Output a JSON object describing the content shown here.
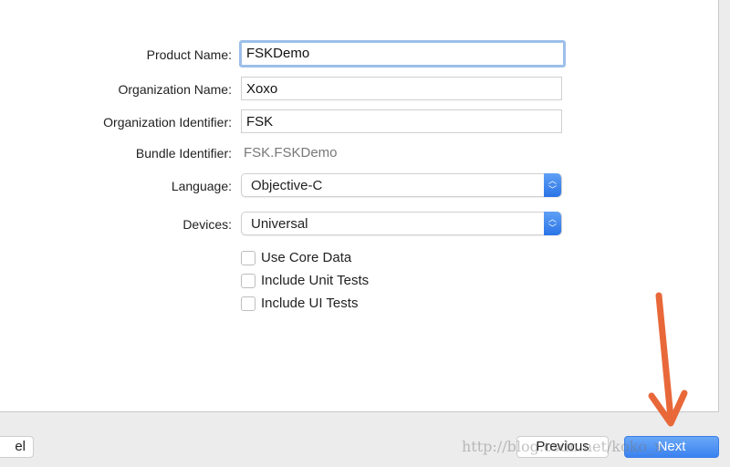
{
  "form": {
    "product_name": {
      "label": "Product Name:",
      "value": "FSKDemo"
    },
    "organization_name": {
      "label": "Organization Name:",
      "value": "Xoxo"
    },
    "organization_identifier": {
      "label": "Organization Identifier:",
      "value": "FSK"
    },
    "bundle_identifier": {
      "label": "Bundle Identifier:",
      "value": "FSK.FSKDemo"
    },
    "language": {
      "label": "Language:",
      "value": "Objective-C"
    },
    "devices": {
      "label": "Devices:",
      "value": "Universal"
    },
    "checkboxes": [
      {
        "label": "Use Core Data",
        "checked": false
      },
      {
        "label": "Include Unit Tests",
        "checked": false
      },
      {
        "label": "Include UI Tests",
        "checked": false
      }
    ]
  },
  "footer": {
    "cancel_label": "el",
    "previous_label": "Previous",
    "next_label": "Next",
    "watermark": "http://blog.csdn.net/koko_x"
  },
  "colors": {
    "accent": "#3b82f0",
    "arrow": "#e8683a",
    "focus_ring": "#9dbfe9"
  },
  "icons": {
    "stepper": "up-down-chevron-icon",
    "annotation": "arrow-down-icon"
  }
}
